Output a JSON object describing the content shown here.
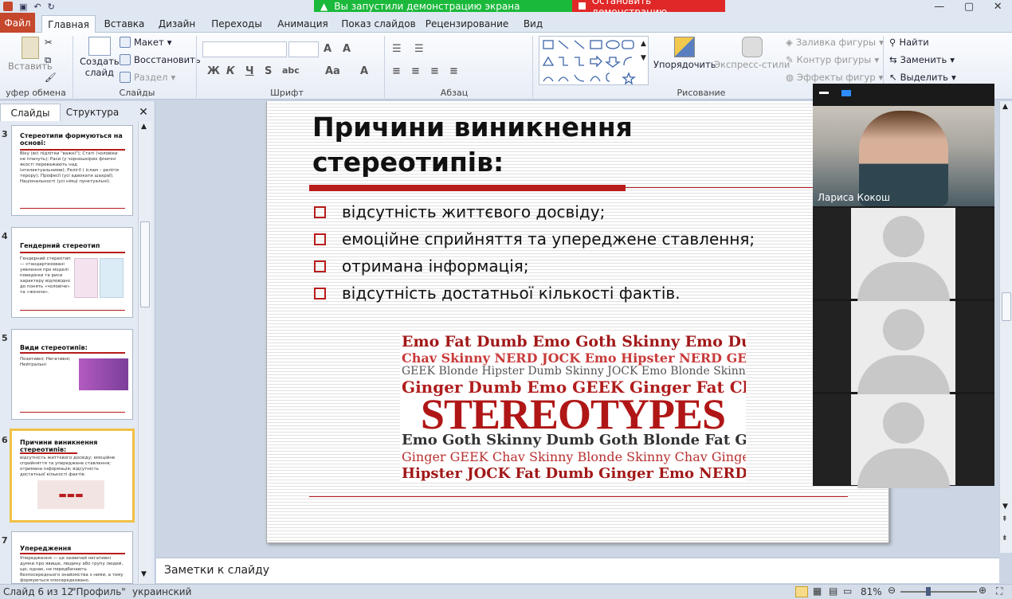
{
  "share": {
    "status": "Вы запустили демонстрацию экрана",
    "stop": "Остановить демонстрацию"
  },
  "tabs": {
    "file": "Файл",
    "home": "Главная",
    "insert": "Вставка",
    "design": "Дизайн",
    "transitions": "Переходы",
    "animation": "Анимация",
    "slideshow": "Показ слайдов",
    "review": "Рецензирование",
    "view": "Вид"
  },
  "ribbon": {
    "paste": "Вставить",
    "new_slide_1": "Создать",
    "new_slide_2": "слайд",
    "layout": "Макет",
    "reset": "Восстановить",
    "section": "Раздел",
    "arrange": "Упорядочить",
    "quick_styles": "Экспресс-стили",
    "shape_fill": "Заливка фигуры",
    "shape_outline": "Контур фигуры",
    "shape_effects": "Эффекты фигур",
    "find": "Найти",
    "replace": "Заменить",
    "select": "Выделить",
    "groups": {
      "clipboard": "уфер обмена",
      "slides": "Слайды",
      "font": "Шрифт",
      "paragraph": "Абзац",
      "drawing": "Рисование"
    }
  },
  "pane": {
    "tab_slides": "Слайды",
    "tab_outline": "Структура",
    "thumbs": [
      {
        "num": "3",
        "title": "Стереотипи формуються на основі:",
        "text": "Віку (всі підлітки \"важкі\"); Статі (чоловіки не плачуть); Раси (у чорношкірих фізичні якості переважають над інтелектуальними); Релігії ( іслам – релігія терору); Професії (усі адвокати шахраї); Національності (усі німці пунктуальні)."
      },
      {
        "num": "4",
        "title": "Гендерний стереотип",
        "text": "Гендерний стереотип — стандартизовані уявлення про моделі поведінки та риси характеру відповідно до понять «чоловіче» та «жіноче»."
      },
      {
        "num": "5",
        "title": "Види стереотипів:",
        "text": "Позитивні; Негативні; Нейтральні"
      },
      {
        "num": "6",
        "title": "Причини виникнення стереотипів:",
        "text": "відсутність життєвого досвіду; емоційне сприйняття та упереджене ставлення; отримана інформація; відсутність достатньої кількості фактів."
      },
      {
        "num": "7",
        "title": "Упередження",
        "text": "Упередження — це зазвичай негативні думки про явище, людину або групу людей, що, однак, не передбачають безпосереднього знайомства з ними, а тому формуються опосередковано."
      }
    ]
  },
  "slide": {
    "title": "Причини виникнення стереотипів:",
    "bullets": [
      "відсутність життєвого досвіду;",
      "емоційне сприйняття та упереджене ставлення;",
      "отримана інформація;",
      "відсутність достатньої кількості фактів."
    ],
    "cloud_rows": [
      "Emo Fat Dumb Emo Goth Skinny Emo Dumb",
      "Chav Skinny NERD JOCK Emo Hipster NERD GEEK",
      "GEEK Blonde Hipster Dumb Skinny JOCK Emo Blonde Skinny",
      "Ginger Dumb Emo GEEK Ginger Fat Chav",
      "STEREOTYPES",
      "Emo Goth Skinny Dumb Goth Blonde Fat Goth",
      "Ginger GEEK Chav Skinny Blonde Skinny Chav Ginger",
      "Hipster JOCK Fat Dumb Ginger Emo NERD"
    ]
  },
  "video": {
    "name": "Лариса Кокош"
  },
  "notes": "Заметки к слайду",
  "status": {
    "slide": "Слайд 6 из 12",
    "theme": "\"Профиль\"",
    "lang": "украинский",
    "zoom": "81%"
  },
  "colors": {
    "accent_red": "#b81c1c",
    "share_green": "#1bb93b",
    "stop_red": "#e02828",
    "file_tab": "#c5472c"
  }
}
